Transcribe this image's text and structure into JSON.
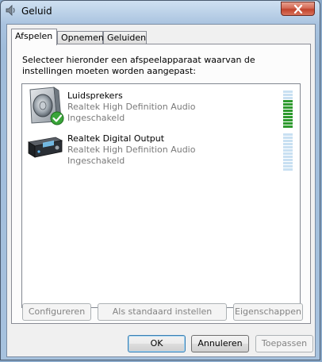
{
  "window": {
    "title": "Geluid"
  },
  "tabs": [
    {
      "label": "Afspelen",
      "active": true
    },
    {
      "label": "Opnemen",
      "active": false
    },
    {
      "label": "Geluiden",
      "active": false
    }
  ],
  "instruction": "Selecteer hieronder een afspeelapparaat waarvan de instellingen moeten worden aangepast:",
  "devices": [
    {
      "name": "Luidsprekers",
      "description": "Realtek High Definition Audio",
      "status": "Ingeschakeld",
      "icon": "speaker-default-icon",
      "default": true,
      "level": 0.75
    },
    {
      "name": "Realtek Digital Output",
      "description": "Realtek High Definition Audio",
      "status": "Ingeschakeld",
      "icon": "digital-output-icon",
      "default": false,
      "level": 0
    }
  ],
  "tab_buttons": {
    "configure": "Configureren",
    "set_default": "Als standaard instellen",
    "properties": "Eigenschappen"
  },
  "dialog_buttons": {
    "ok": "OK",
    "cancel": "Annuleren",
    "apply": "Toepassen"
  },
  "colors": {
    "meter_active": "#2f9a2f",
    "meter_inactive": "#c9e0f2",
    "default_badge": "#3aa53a"
  }
}
